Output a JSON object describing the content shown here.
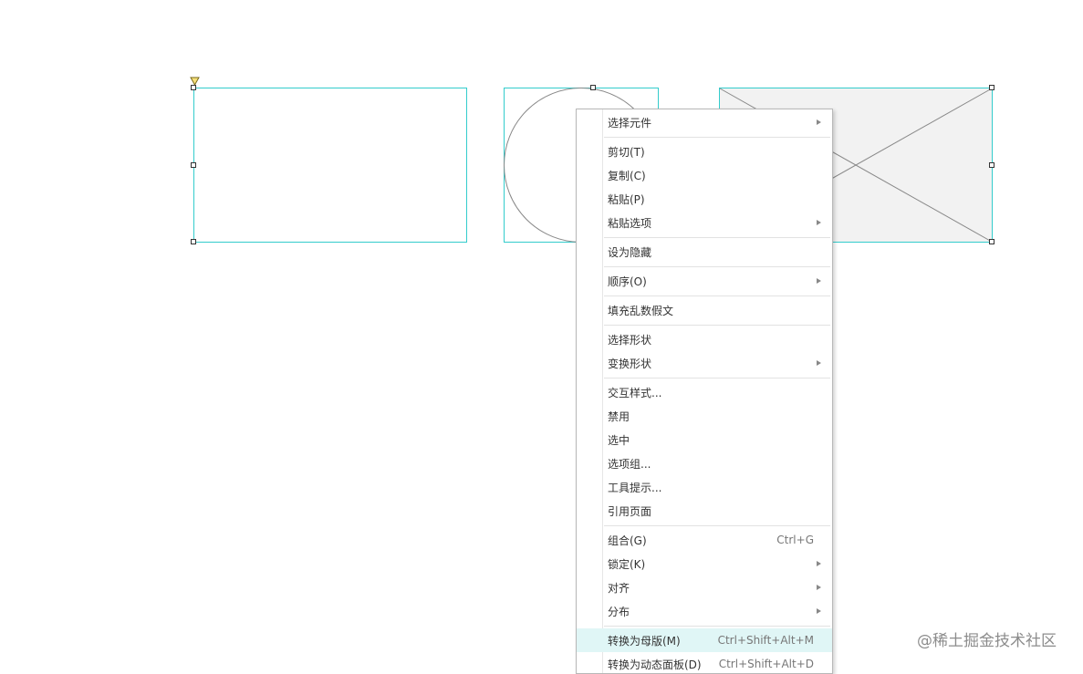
{
  "menu": {
    "items": [
      {
        "label": "选择元件",
        "shortcut": "",
        "submenu": true
      },
      {
        "label": "剪切(T)",
        "shortcut": "",
        "submenu": false
      },
      {
        "label": "复制(C)",
        "shortcut": "",
        "submenu": false
      },
      {
        "label": "粘贴(P)",
        "shortcut": "",
        "submenu": false
      },
      {
        "label": "粘贴选项",
        "shortcut": "",
        "submenu": true
      },
      {
        "label": "设为隐藏",
        "shortcut": "",
        "submenu": false
      },
      {
        "label": "顺序(O)",
        "shortcut": "",
        "submenu": true
      },
      {
        "label": "填充乱数假文",
        "shortcut": "",
        "submenu": false
      },
      {
        "label": "选择形状",
        "shortcut": "",
        "submenu": false
      },
      {
        "label": "变换形状",
        "shortcut": "",
        "submenu": true
      },
      {
        "label": "交互样式...",
        "shortcut": "",
        "submenu": false
      },
      {
        "label": "禁用",
        "shortcut": "",
        "submenu": false
      },
      {
        "label": "选中",
        "shortcut": "",
        "submenu": false
      },
      {
        "label": "选项组...",
        "shortcut": "",
        "submenu": false
      },
      {
        "label": "工具提示...",
        "shortcut": "",
        "submenu": false
      },
      {
        "label": "引用页面",
        "shortcut": "",
        "submenu": false
      },
      {
        "label": "组合(G)",
        "shortcut": "Ctrl+G",
        "submenu": false
      },
      {
        "label": "锁定(K)",
        "shortcut": "",
        "submenu": true
      },
      {
        "label": "对齐",
        "shortcut": "",
        "submenu": true
      },
      {
        "label": "分布",
        "shortcut": "",
        "submenu": true
      },
      {
        "label": "转换为母版(M)",
        "shortcut": "Ctrl+Shift+Alt+M",
        "submenu": false,
        "highlighted": true
      },
      {
        "label": "转换为动态面板(D)",
        "shortcut": "Ctrl+Shift+Alt+D",
        "submenu": false
      }
    ]
  },
  "watermark": "@稀土掘金技术社区",
  "colors": {
    "selection": "#33cccc",
    "menu_highlight": "#e0f6f6",
    "placeholder_fill": "#f2f2f2",
    "shape_stroke": "#888888"
  }
}
